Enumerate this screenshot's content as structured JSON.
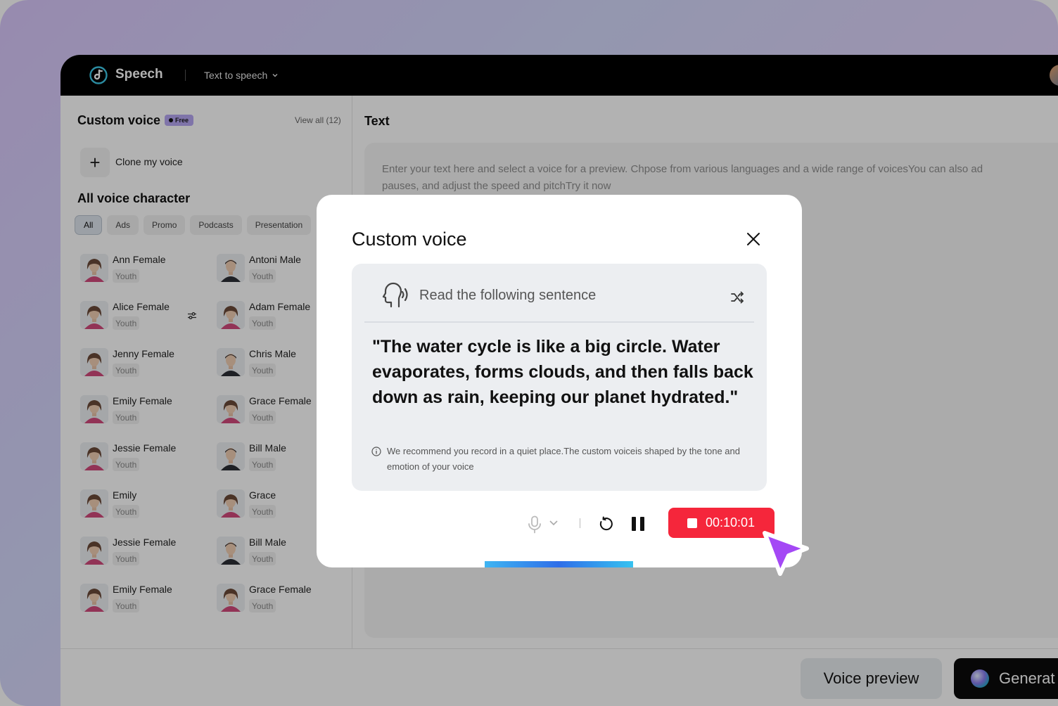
{
  "app": {
    "brand": "Speech",
    "menu": "Text to speech"
  },
  "left": {
    "title": "Custom voice",
    "badge": "Free",
    "view_all": "View all (12)",
    "clone_label": "Clone my voice",
    "all_title": "All voice character",
    "filters": [
      "All",
      "Ads",
      "Promo",
      "Podcasts",
      "Presentation"
    ],
    "voices": [
      {
        "name": "Ann Female",
        "tag": "Youth",
        "gender": "female"
      },
      {
        "name": "Antoni Male",
        "tag": "Youth",
        "gender": "male"
      },
      {
        "name": "Alice Female",
        "tag": "Youth",
        "gender": "female"
      },
      {
        "name": "Adam Female",
        "tag": "Youth",
        "gender": "female"
      },
      {
        "name": "Jenny Female",
        "tag": "Youth",
        "gender": "female"
      },
      {
        "name": "Chris Male",
        "tag": "Youth",
        "gender": "male"
      },
      {
        "name": "Emily Female",
        "tag": "Youth",
        "gender": "female"
      },
      {
        "name": "Grace Female",
        "tag": "Youth",
        "gender": "female"
      },
      {
        "name": "Jessie Female",
        "tag": "Youth",
        "gender": "female"
      },
      {
        "name": "Bill Male",
        "tag": "Youth",
        "gender": "male"
      },
      {
        "name": "Emily",
        "tag": "Youth",
        "gender": "female"
      },
      {
        "name": "Grace",
        "tag": "Youth",
        "gender": "female"
      },
      {
        "name": "Jessie Female",
        "tag": "Youth",
        "gender": "female"
      },
      {
        "name": "Bill Male",
        "tag": "Youth",
        "gender": "male"
      },
      {
        "name": "Emily Female",
        "tag": "Youth",
        "gender": "female"
      },
      {
        "name": "Grace Female",
        "tag": "Youth",
        "gender": "female"
      }
    ]
  },
  "right": {
    "title": "Text",
    "placeholder_line1": "Enter your text here and select a voice for a preview. Chpose from various languages and a wide range of voicesYou can also ad",
    "placeholder_line2": "pauses, and adjust the speed and pitchTry it now"
  },
  "bottom": {
    "preview": "Voice preview",
    "generate": "Generat"
  },
  "modal": {
    "title": "Custom voice",
    "read_label": "Read the following sentence",
    "sentence": "\"The water cycle is like a big circle. Water evaporates, forms clouds, and then falls back down as rain, keeping our planet hydrated.\"",
    "tip": "We recommend you record in a quiet place.The custom voiceis shaped by the tone and emotion of your voice",
    "timer": "00:10:01"
  },
  "colors": {
    "record": "#f5263b",
    "cursor": "#a448f5",
    "badge": "#b7a6f2"
  }
}
